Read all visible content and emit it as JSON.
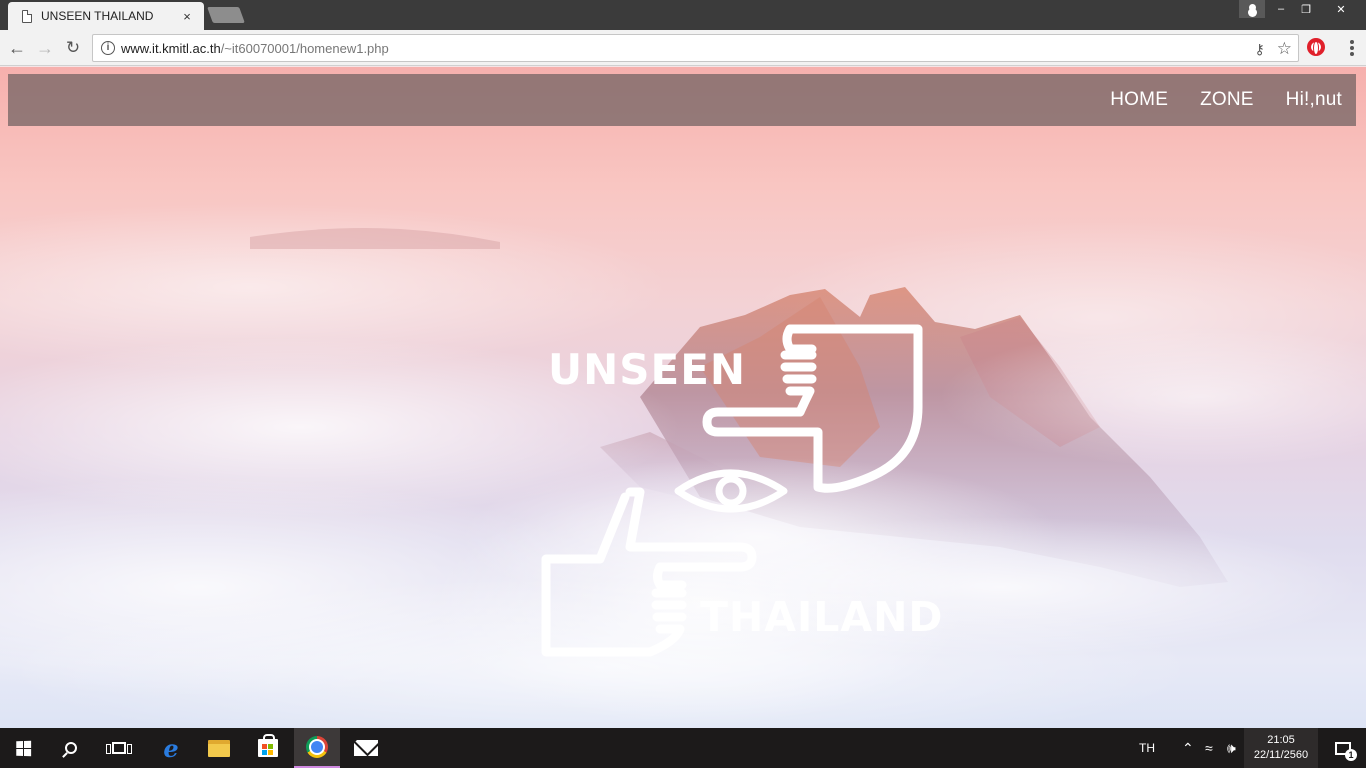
{
  "browser": {
    "tab_title": "UNSEEN THAILAND",
    "tab_close": "×",
    "url_host": "www.it.kmitl.ac.th",
    "url_path": "/~it60070001/homenew1.php"
  },
  "window_controls": {
    "minimize": "–",
    "maximize": "❐",
    "close": "✕"
  },
  "site": {
    "nav": [
      {
        "label": "HOME"
      },
      {
        "label": "ZONE"
      },
      {
        "label": "Hi!,nut"
      }
    ],
    "logo": {
      "top_word": "UNSEEN",
      "bottom_word": "THAILAND"
    }
  },
  "taskbar": {
    "language": "TH",
    "time": "21:05",
    "date": "22/11/2560",
    "notification_count": "1",
    "apps": [
      "start-icon",
      "search-icon",
      "task-view-icon",
      "edge-icon",
      "file-explorer-icon",
      "store-icon",
      "chrome-icon",
      "mail-icon"
    ]
  },
  "colors": {
    "navbar_bg": "#6e6060",
    "sky_top": "#f6b0ad",
    "sky_bottom": "#dde4f5",
    "taskbar_bg": "#1c1a1a"
  }
}
